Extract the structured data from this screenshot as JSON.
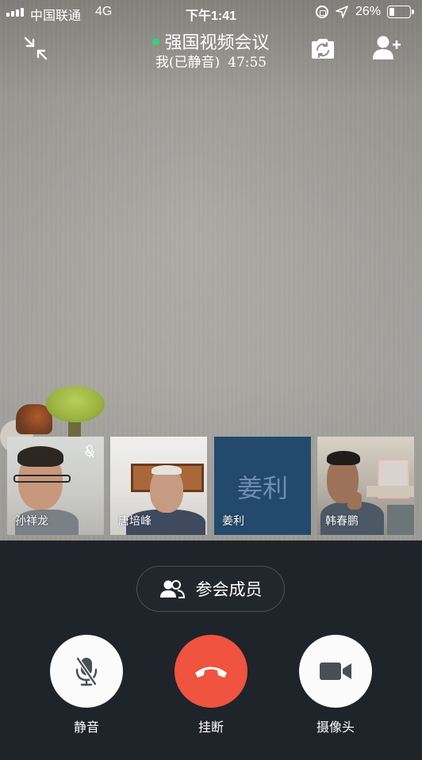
{
  "status_bar": {
    "carrier": "中国联通",
    "network": "4G",
    "time": "下午1:41",
    "battery_percent": "26%",
    "battery_level": 0.26
  },
  "header": {
    "title": "强国视频会议",
    "self_status": "我(已静音)",
    "elapsed": "47:55",
    "live_color": "#35d07f"
  },
  "participants": [
    {
      "name": "孙祥龙",
      "muted": true
    },
    {
      "name": "唐培峰"
    },
    {
      "name": "姜利",
      "avatar_text": "姜利",
      "avatar_bg": "#234a6d"
    },
    {
      "name": "韩春鹏"
    }
  ],
  "controls": {
    "members_label": "参会成员",
    "mute_label": "静音",
    "hangup_label": "挂断",
    "camera_label": "摄像头",
    "hangup_color": "#f0533f"
  },
  "icons": {
    "minimize": "shrink-arrows-icon",
    "switch_camera": "camera-switch-icon",
    "add_member": "add-user-icon",
    "members": "people-icon",
    "mute": "mic-off-icon",
    "hangup": "phone-hangup-icon",
    "camera": "video-camera-icon"
  }
}
